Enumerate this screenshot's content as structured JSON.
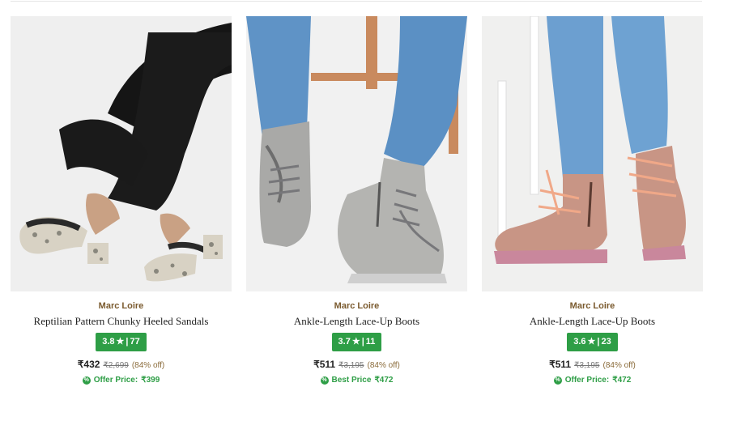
{
  "products": [
    {
      "brand": "Marc Loire",
      "title": "Reptilian Pattern Chunky Heeled Sandals",
      "rating": "3.8",
      "reviews": "77",
      "price": "₹432",
      "mrp": "₹2,699",
      "discount": "(84% off)",
      "offer_label": "Offer Price:",
      "offer_price": "₹399",
      "image": "woman-in-black-jeans-wearing-snakeskin-heeled-mules"
    },
    {
      "brand": "Marc Loire",
      "title": "Ankle-Length Lace-Up Boots",
      "rating": "3.7",
      "reviews": "11",
      "price": "₹511",
      "mrp": "₹3,195",
      "discount": "(84% off)",
      "offer_label": "Best Price",
      "offer_price": "₹472",
      "image": "grey-lace-up-ankle-boots-with-blue-jeans"
    },
    {
      "brand": "Marc Loire",
      "title": "Ankle-Length Lace-Up Boots",
      "rating": "3.6",
      "reviews": "23",
      "price": "₹511",
      "mrp": "₹3,195",
      "discount": "(84% off)",
      "offer_label": "Offer Price:",
      "offer_price": "₹472",
      "image": "pink-lace-up-ankle-boots-with-blue-jeans"
    }
  ],
  "symbols": {
    "star": "★",
    "separator": "|",
    "offer_icon": "%"
  },
  "colors": {
    "rating_bg": "#2e9e46",
    "brand": "#7a5a2e",
    "offer": "#2e9e46"
  }
}
